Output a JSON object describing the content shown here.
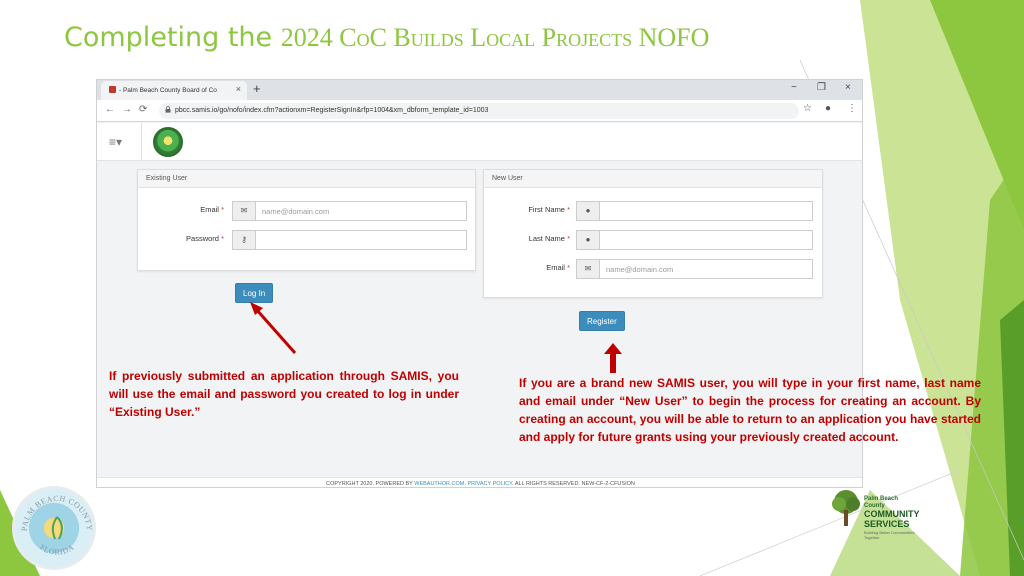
{
  "slide": {
    "title_part1": "Completing the ",
    "title_part2": "2024 CoC Builds Local Projects NOFO"
  },
  "browser": {
    "tab_title": "- Palm Beach County Board of Co",
    "tab_close": "×",
    "new_tab": "+",
    "window_controls": {
      "minimize": "−",
      "restore": "❐",
      "close": "×"
    },
    "url": "pbcc.samis.io/go/nofo/index.cfm?actionxm=RegisterSignIn&rfp=1004&xm_dbform_template_id=1003",
    "nav": {
      "back": "←",
      "forward": "→",
      "reload": "⟳"
    },
    "toolbar": {
      "bookmark": "☆",
      "account": "●",
      "menu": "⋮"
    }
  },
  "site": {
    "menu_icon": "≡▾",
    "existing_user": {
      "heading": "Existing User",
      "email_label": "Email",
      "email_placeholder": "name@domain.com",
      "password_label": "Password",
      "login_button": "Log In"
    },
    "new_user": {
      "heading": "New User",
      "first_name_label": "First Name",
      "last_name_label": "Last Name",
      "email_label": "Email",
      "email_placeholder": "name@domain.com",
      "register_button": "Register"
    },
    "required_mark": "*",
    "footer": {
      "prefix": "COPYRIGHT 2020. POWERED BY ",
      "webauthor": "WEBAUTHOR.COM",
      "sep": ". ",
      "privacy": "PRIVACY POLICY",
      "suffix": ". ALL RIGHTS RESERVED. NEW-CF-2-CFUSION"
    }
  },
  "notes": {
    "existing": "If previously submitted an application through SAMIS, you will use the email and password you created to log in under “Existing User.”",
    "new": "If you are a brand new SAMIS user, you will type in your first name, last name and email under “New User” to begin the process for creating an account.  By creating an account, you will be able to return to an application you have started and apply for future grants using your previously created account."
  },
  "logos": {
    "seal_top": "PALM BEACH COUNTY",
    "seal_bottom": "FLORIDA",
    "cs_line1": "Palm Beach County",
    "cs_line2": "COMMUNITY",
    "cs_line3": "SERVICES",
    "cs_tagline": "Building Better Communities Together"
  },
  "colors": {
    "title": "#8dc63f",
    "note_text": "#c00000",
    "button": "#3c8dbc",
    "deco_light": "#c5e08a",
    "deco_mid": "#8dc63f",
    "deco_dark": "#5a9e2a"
  },
  "icons": {
    "email": "envelope-icon",
    "password": "key-icon",
    "user": "user-icon",
    "lock": "lock-icon"
  }
}
